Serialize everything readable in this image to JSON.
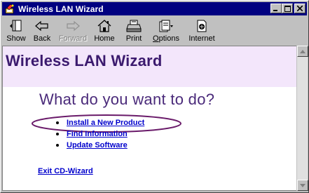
{
  "window": {
    "title": "Wireless LAN Wizard"
  },
  "toolbar": {
    "show": "Show",
    "back": "Back",
    "forward": "Forward",
    "home": "Home",
    "print": "Print",
    "options_prefix": "O",
    "options_rest": "ptions",
    "internet": "Internet"
  },
  "content": {
    "heading": "Wireless LAN Wizard",
    "question": "What do you want to do?",
    "options": [
      {
        "label": "Install a New Product",
        "highlighted": true
      },
      {
        "label": "Find Information"
      },
      {
        "label": "Update Software"
      }
    ],
    "exit_link": "Exit CD-Wizard"
  },
  "colors": {
    "titlebar": "#000080",
    "header_band": "#f3e6fb",
    "link": "#0000cc",
    "highlight_ring": "#6a1b6a"
  }
}
